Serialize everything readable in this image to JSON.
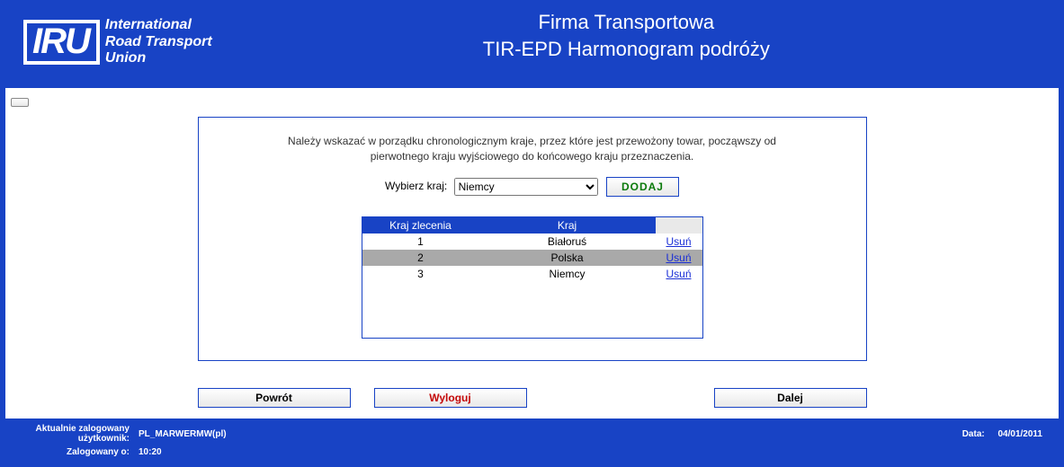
{
  "logo": {
    "abbr": "IRU",
    "line1": "International",
    "line2": "Road Transport",
    "line3": "Union"
  },
  "header": {
    "title1": "Firma Transportowa",
    "title2": "TIR-EPD Harmonogram podróży"
  },
  "instructions": {
    "line1": "Należy wskazać w porządku chronologicznym kraje, przez które jest przewożony towar, począwszy od",
    "line2": "pierwotnego kraju wyjściowego do końcowego kraju przeznaczenia."
  },
  "select": {
    "label": "Wybierz kraj:",
    "selected": "Niemcy",
    "add_label": "DODAJ"
  },
  "grid": {
    "headers": {
      "order": "Kraj zlecenia",
      "country": "Kraj"
    },
    "delete_label": "Usuń",
    "rows": [
      {
        "order": "1",
        "country": "Białoruś",
        "selected": false
      },
      {
        "order": "2",
        "country": "Polska",
        "selected": true
      },
      {
        "order": "3",
        "country": "Niemcy",
        "selected": false
      }
    ]
  },
  "buttons": {
    "back": "Powrót",
    "logout": "Wyloguj",
    "next": "Dalej"
  },
  "footer": {
    "user_label": "Aktualnie zalogowany użytkownik:",
    "user_value": "PL_MARWERMW(pl)",
    "date_label": "Data:",
    "date_value": "04/01/2011",
    "login_time_label": "Zalogowany o:",
    "login_time_value": "10:20"
  }
}
